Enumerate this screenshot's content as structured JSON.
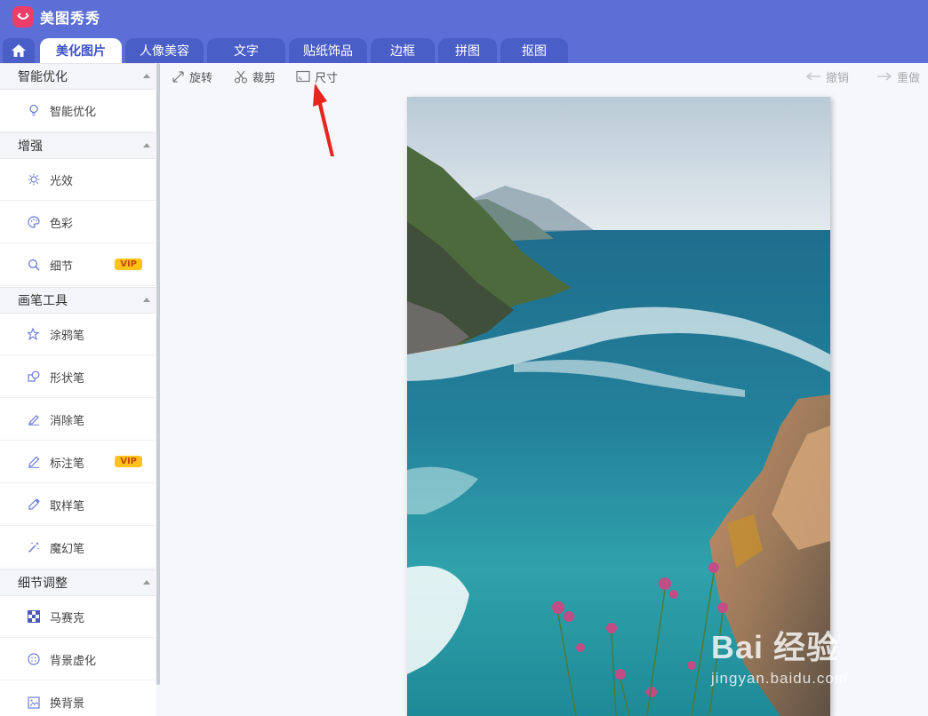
{
  "app": {
    "title": "美图秀秀"
  },
  "tabs": [
    "美化图片",
    "人像美容",
    "文字",
    "贴纸饰品",
    "边框",
    "拼图",
    "抠图"
  ],
  "sidebar": {
    "groups": [
      {
        "title": "智能优化",
        "items": [
          {
            "label": "智能优化",
            "icon": "bulb-icon"
          }
        ]
      },
      {
        "title": "增强",
        "items": [
          {
            "label": "光效",
            "icon": "sun-icon"
          },
          {
            "label": "色彩",
            "icon": "palette-icon"
          },
          {
            "label": "细节",
            "icon": "magnifier-icon",
            "badge": "VIP"
          }
        ]
      },
      {
        "title": "画笔工具",
        "items": [
          {
            "label": "涂鸦笔",
            "icon": "sparkle-pen-icon"
          },
          {
            "label": "形状笔",
            "icon": "shapes-icon"
          },
          {
            "label": "消除笔",
            "icon": "eraser-pen-icon"
          },
          {
            "label": "标注笔",
            "icon": "pen-icon",
            "badge": "VIP"
          },
          {
            "label": "取样笔",
            "icon": "dropper-icon"
          },
          {
            "label": "魔幻笔",
            "icon": "magic-wand-icon"
          }
        ]
      },
      {
        "title": "细节调整",
        "items": [
          {
            "label": "马赛克",
            "icon": "mosaic-icon"
          },
          {
            "label": "背景虚化",
            "icon": "blur-icon"
          },
          {
            "label": "换背景",
            "icon": "background-icon"
          }
        ]
      }
    ]
  },
  "toolbar": {
    "rotate": "旋转",
    "crop": "裁剪",
    "size": "尺寸",
    "undo": "撤销",
    "redo": "重做"
  },
  "watermark": {
    "main": "Bai 经验",
    "sub": "jingyan.baidu.com"
  },
  "colors": {
    "header": "#5b6fd6",
    "tab": "#4a5ec8",
    "accent": "#3d52c4",
    "vip": "#ffc21a",
    "arrow": "#e8241e"
  }
}
